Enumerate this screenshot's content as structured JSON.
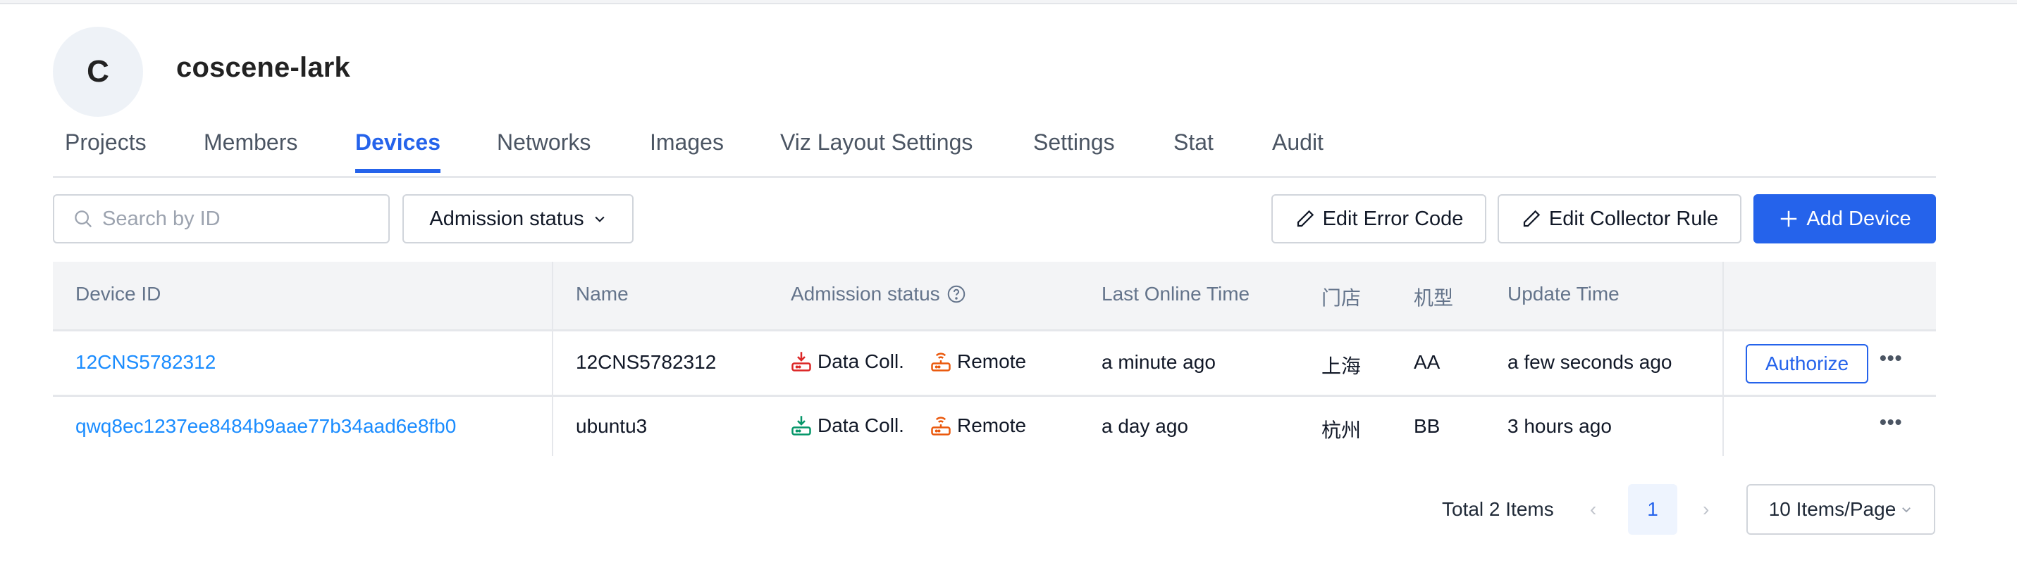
{
  "org": {
    "avatar_letter": "C",
    "name": "coscene-lark"
  },
  "tabs": [
    {
      "label": "Projects",
      "active": false
    },
    {
      "label": "Members",
      "active": false
    },
    {
      "label": "Devices",
      "active": true
    },
    {
      "label": "Networks",
      "active": false
    },
    {
      "label": "Images",
      "active": false
    },
    {
      "label": "Viz Layout Settings",
      "active": false
    },
    {
      "label": "Settings",
      "active": false
    },
    {
      "label": "Stat",
      "active": false
    },
    {
      "label": "Audit",
      "active": false
    }
  ],
  "toolbar": {
    "search_placeholder": "Search by ID",
    "search_value": "",
    "admission_filter_label": "Admission status",
    "edit_error_code_label": "Edit Error Code",
    "edit_collector_rule_label": "Edit Collector Rule",
    "add_device_label": "Add Device"
  },
  "table": {
    "columns": [
      "Device ID",
      "Name",
      "Admission status",
      "Last Online Time",
      "门店",
      "机型",
      "Update Time",
      ""
    ],
    "rows": [
      {
        "device_id": "12CNS5782312",
        "name": "12CNS5782312",
        "data_coll": {
          "label": "Data Coll.",
          "state": "unauthorized",
          "color": "#dc2626"
        },
        "remote": {
          "label": "Remote",
          "color": "#ea580c"
        },
        "last_online": "a minute ago",
        "store": "上海",
        "model": "AA",
        "update_time": "a few seconds ago",
        "action_label": "Authorize"
      },
      {
        "device_id": "qwq8ec1237ee8484b9aae77b34aad6e8fb0",
        "name": "ubuntu3",
        "data_coll": {
          "label": "Data Coll.",
          "state": "authorized",
          "color": "#059669"
        },
        "remote": {
          "label": "Remote",
          "color": "#ea580c"
        },
        "last_online": "a day ago",
        "store": "杭州",
        "model": "BB",
        "update_time": "3 hours ago",
        "action_label": ""
      }
    ]
  },
  "pagination": {
    "total_label": "Total 2 Items",
    "current_page": "1",
    "page_size_label": "10 Items/Page"
  },
  "colors": {
    "accent": "#2563eb",
    "link": "#1a8cff"
  }
}
